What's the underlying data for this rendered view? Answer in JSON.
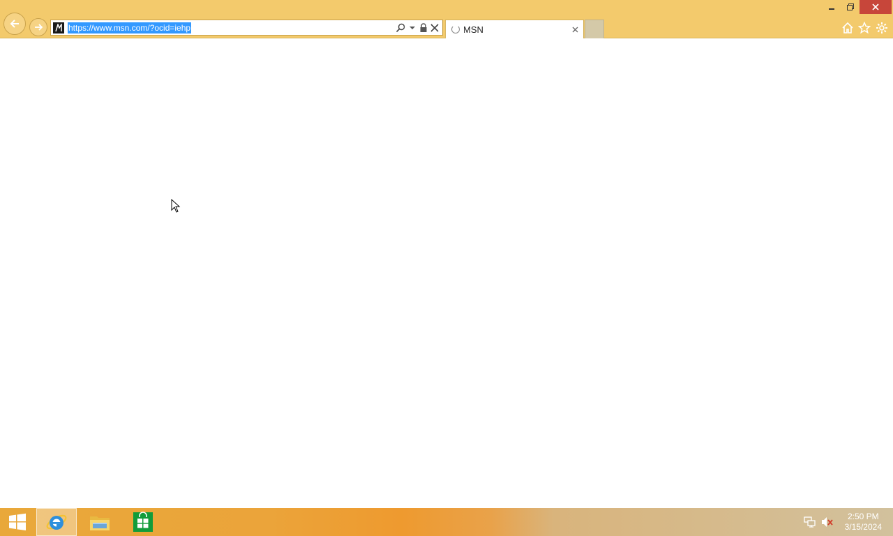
{
  "browser": {
    "address_bar": {
      "url": "https://www.msn.com/?ocid=iehp"
    },
    "tabs": [
      {
        "title": "MSN",
        "state": "loading"
      }
    ],
    "icons": {
      "back": "back-arrow-icon",
      "forward": "forward-arrow-icon",
      "search": "search-icon",
      "dropdown": "chevron-down-icon",
      "lock": "lock-icon",
      "stop": "close-icon",
      "home": "home-icon",
      "favorites": "star-icon",
      "tools": "gear-icon"
    },
    "colors": {
      "chrome": "#f3ca6c",
      "url_selection": "#3399ff",
      "close_button": "#c7463a"
    }
  },
  "taskbar": {
    "pinned": [
      {
        "name": "Internet Explorer",
        "icon": "internet-explorer-icon",
        "active": true
      },
      {
        "name": "File Explorer",
        "icon": "folder-icon",
        "active": false
      },
      {
        "name": "Store",
        "icon": "store-icon",
        "active": false
      }
    ],
    "tray": {
      "network_icon": "network-icon",
      "volume_icon": "speaker-muted-icon"
    },
    "clock": {
      "time": "2:50 PM",
      "date": "3/15/2024"
    }
  }
}
